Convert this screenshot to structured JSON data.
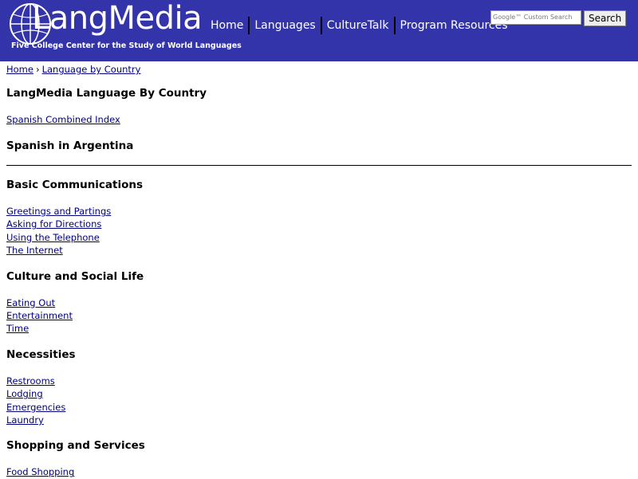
{
  "header": {
    "logo_title": "LangMedia",
    "logo_subtitle": "Five College Center for the Study of World Languages",
    "nav": [
      "Home",
      "Languages",
      "CultureTalk",
      "Program Resources"
    ],
    "search": {
      "placeholder": "Custom Search",
      "google_label": "Google™ Custom Search",
      "button": "Search"
    }
  },
  "breadcrumb": {
    "home": "Home",
    "sep": "›",
    "current": "Language by Country"
  },
  "page_title": "LangMedia Language By Country",
  "index_link": "Spanish Combined Index",
  "subtitle": "Spanish in Argentina",
  "sections": [
    {
      "title": "Basic Communications",
      "links": [
        "Greetings and Partings",
        "Asking for Directions",
        "Using the Telephone",
        "The Internet"
      ]
    },
    {
      "title": "Culture and Social Life",
      "links": [
        "Eating Out",
        "Entertainment",
        "Time"
      ]
    },
    {
      "title": "Necessities",
      "links": [
        "Restrooms",
        "Lodging",
        "Emergencies",
        "Laundry"
      ]
    },
    {
      "title": "Shopping and Services",
      "links": [
        "Food Shopping"
      ]
    }
  ]
}
